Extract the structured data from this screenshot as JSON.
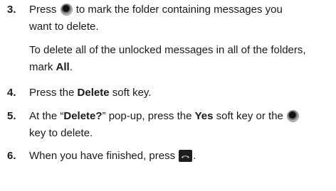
{
  "steps": [
    {
      "number": "3.",
      "lines": [
        {
          "pre": "Press",
          "post": "to mark the folder containing messages you"
        },
        {
          "text": "want to delete."
        },
        {
          "text": "To delete all of the unlocked messages in all of the folders,"
        },
        {
          "pre": "mark",
          "bold": "All",
          "post": "."
        }
      ]
    },
    {
      "number": "4.",
      "lines": [
        {
          "pre": "Press the",
          "bold": "Delete",
          "post": "soft key."
        }
      ]
    },
    {
      "number": "5.",
      "lines": [
        {
          "a": "At the “",
          "b": "Delete?",
          "c": "” pop-up, press the",
          "d": "Yes",
          "e": "soft key or the"
        },
        {
          "text": "key to delete."
        }
      ]
    },
    {
      "number": "6.",
      "lines": [
        {
          "pre": "When you have finished, press",
          "post": "."
        }
      ]
    }
  ],
  "icons": {
    "ok_key": "ok-key-icon",
    "end_key": "end-key-icon"
  }
}
